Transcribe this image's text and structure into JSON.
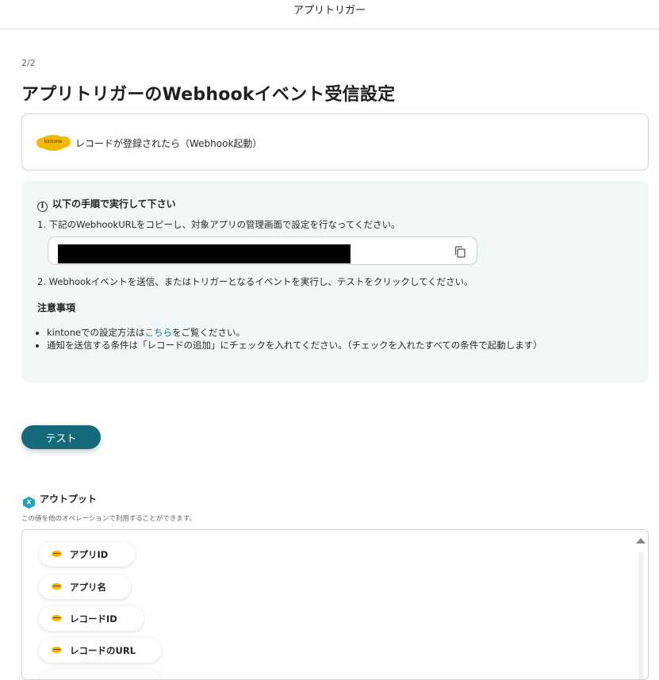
{
  "header": {
    "title": "アプリトリガー"
  },
  "step": "2/2",
  "page_title": "アプリトリガーのWebhookイベント受信設定",
  "trigger": {
    "logo_text": "kintone",
    "label": "レコードが登録されたら（Webhook起動）"
  },
  "instructions": {
    "heading": "以下の手順で実行して下さい",
    "step1": "1. 下記のWebhookURLをコピーし、対象アプリの管理画面で設定を行なってください。",
    "step2": "2. Webhookイベントを送信、またはトリガーとなるイベントを実行し、テストをクリックしてください。",
    "notes_heading": "注意事項",
    "note1_pre": "kintoneでの設定方法は",
    "note1_link": "こちら",
    "note1_post": "をご覧ください。",
    "note2": "通知を送信する条件は「レコードの追加」にチェックを入れてください。（チェックを入れたすべての条件で起動します）"
  },
  "test_button": "テスト",
  "output": {
    "heading": "アウトプット",
    "badge": "x",
    "note": "この値を他のオペレーションで利用することができます。",
    "items": [
      {
        "label": "アプリID"
      },
      {
        "label": "アプリ名"
      },
      {
        "label": "レコードID"
      },
      {
        "label": "レコードのURL"
      }
    ]
  },
  "colors": {
    "accent": "#16697a",
    "link": "#17738c",
    "info_bg": "#f2f8f8",
    "kintone_yellow": "#f5b800"
  }
}
